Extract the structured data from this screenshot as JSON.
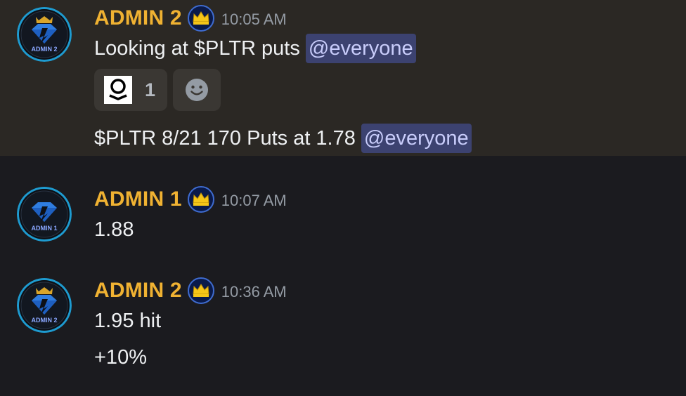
{
  "messages": [
    {
      "username": "ADMIN 2",
      "avatar_label": "ADMIN 2",
      "badge_icon": "crown-icon",
      "timestamp": "10:05 AM",
      "lines": [
        {
          "text": "Looking at $PLTR puts",
          "mention": "@everyone"
        },
        {
          "text": "$PLTR 8/21 170 Puts at 1.78",
          "mention": "@everyone"
        }
      ],
      "reactions": [
        {
          "emoji": "palantir-logo-icon",
          "count": "1"
        }
      ],
      "add_reaction_icon": "add-reaction-smiley-icon"
    },
    {
      "username": "ADMIN 1",
      "avatar_label": "ADMIN 1",
      "badge_icon": "crown-icon",
      "timestamp": "10:07 AM",
      "lines": [
        {
          "text": "1.88"
        }
      ]
    },
    {
      "username": "ADMIN 2",
      "avatar_label": "ADMIN 2",
      "badge_icon": "crown-icon",
      "timestamp": "10:36 AM",
      "lines": [
        {
          "text": "1.95 hit"
        },
        {
          "text": "+10%"
        }
      ]
    }
  ],
  "colors": {
    "background": "#1b1b1f",
    "highlight": "#2b2824",
    "username": "#f0b232",
    "mention_bg": "#3c4270",
    "mention_text": "#c9cdfb",
    "timestamp": "#949ba4"
  }
}
